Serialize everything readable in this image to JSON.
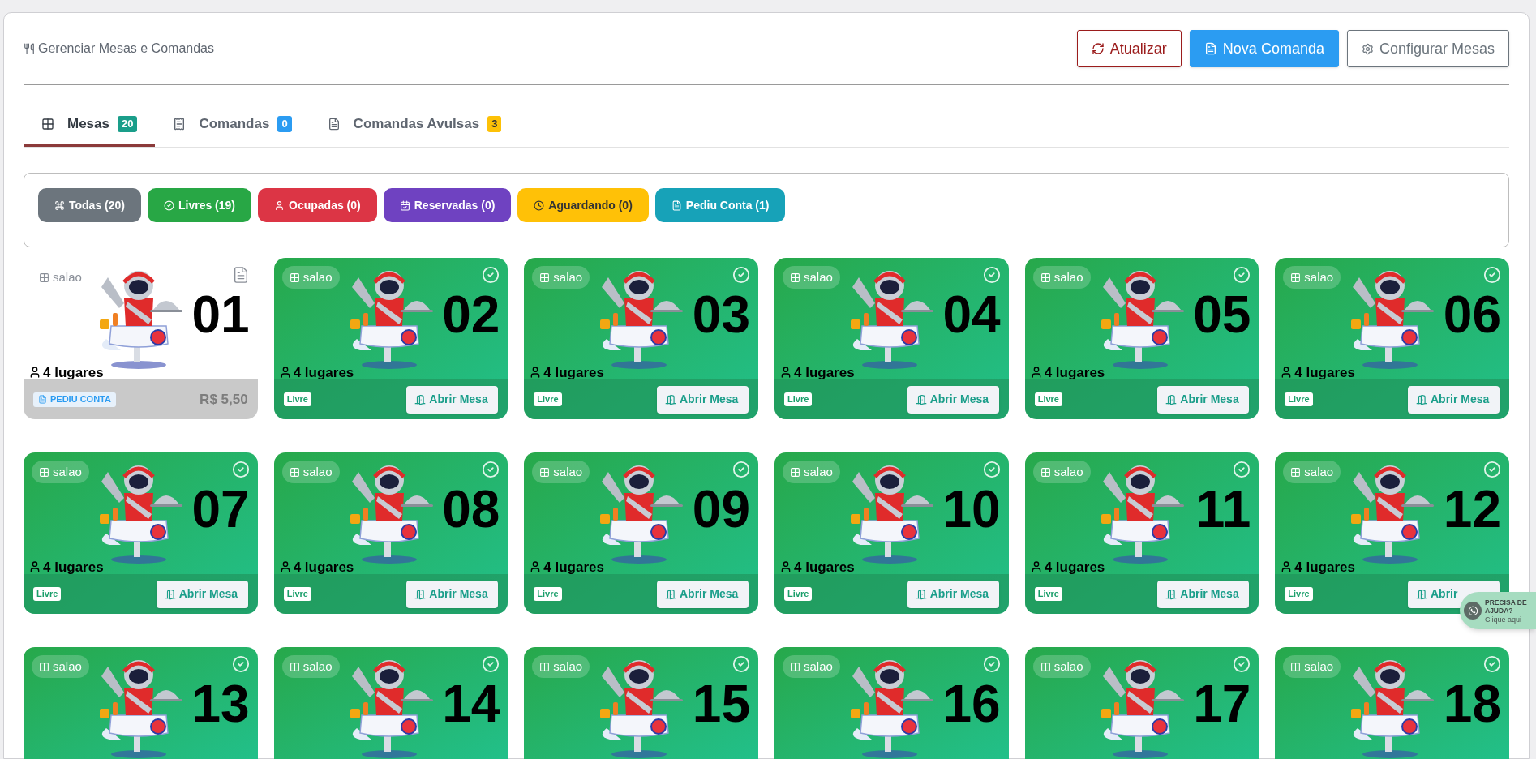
{
  "header": {
    "title": "Gerenciar Mesas e Comandas",
    "buttons": [
      {
        "label": "Atualizar",
        "kind": "refresh"
      },
      {
        "label": "Nova Comanda",
        "kind": "new"
      },
      {
        "label": "Configurar Mesas",
        "kind": "settings"
      }
    ]
  },
  "tabs": [
    {
      "label": "Mesas",
      "count": "20",
      "kind": "tables",
      "selected": true,
      "color": "#1a9e8a"
    },
    {
      "label": "Comandas",
      "count": "0",
      "kind": "orders",
      "selected": false,
      "color": "#2b9cf2"
    },
    {
      "label": "Comandas Avulsas",
      "count": "3",
      "kind": "loose",
      "selected": false,
      "color": "#fdc107"
    }
  ],
  "filters": [
    {
      "label": "Todas (20)",
      "kind": "all",
      "color": "#6c757d"
    },
    {
      "label": "Livres (19)",
      "kind": "free",
      "color": "#28a745"
    },
    {
      "label": "Ocupadas (0)",
      "kind": "occupied",
      "color": "#dc3545"
    },
    {
      "label": "Reservadas (0)",
      "kind": "reserved",
      "color": "#6f42c1"
    },
    {
      "label": "Aguardando (0)",
      "kind": "waiting",
      "color": "#ffc107"
    },
    {
      "label": "Pediu Conta (1)",
      "kind": "bill",
      "color": "#17a2b8"
    }
  ],
  "tables": [
    {
      "area": "salao",
      "number": "01",
      "seats": "4 lugares",
      "kind": "bill",
      "badge": "PEDIU CONTA",
      "amount": "R$ 5,50"
    },
    {
      "area": "salao",
      "number": "02",
      "seats": "4 lugares",
      "kind": "free",
      "badge": "Livre",
      "action": "Abrir Mesa"
    },
    {
      "area": "salao",
      "number": "03",
      "seats": "4 lugares",
      "kind": "free",
      "badge": "Livre",
      "action": "Abrir Mesa"
    },
    {
      "area": "salao",
      "number": "04",
      "seats": "4 lugares",
      "kind": "free",
      "badge": "Livre",
      "action": "Abrir Mesa"
    },
    {
      "area": "salao",
      "number": "05",
      "seats": "4 lugares",
      "kind": "free",
      "badge": "Livre",
      "action": "Abrir Mesa"
    },
    {
      "area": "salao",
      "number": "06",
      "seats": "4 lugares",
      "kind": "free",
      "badge": "Livre",
      "action": "Abrir Mesa"
    },
    {
      "area": "salao",
      "number": "07",
      "seats": "4 lugares",
      "kind": "free",
      "badge": "Livre",
      "action": "Abrir Mesa"
    },
    {
      "area": "salao",
      "number": "08",
      "seats": "4 lugares",
      "kind": "free",
      "badge": "Livre",
      "action": "Abrir Mesa"
    },
    {
      "area": "salao",
      "number": "09",
      "seats": "4 lugares",
      "kind": "free",
      "badge": "Livre",
      "action": "Abrir Mesa"
    },
    {
      "area": "salao",
      "number": "10",
      "seats": "4 lugares",
      "kind": "free",
      "badge": "Livre",
      "action": "Abrir Mesa"
    },
    {
      "area": "salao",
      "number": "11",
      "seats": "4 lugares",
      "kind": "free",
      "badge": "Livre",
      "action": "Abrir Mesa"
    },
    {
      "area": "salao",
      "number": "12",
      "seats": "4 lugares",
      "kind": "free",
      "badge": "Livre",
      "action": "Abrir"
    },
    {
      "area": "salao",
      "number": "13",
      "kind": "free"
    },
    {
      "area": "salao",
      "number": "14",
      "kind": "free"
    },
    {
      "area": "salao",
      "number": "15",
      "kind": "free"
    },
    {
      "area": "salao",
      "number": "16",
      "kind": "free"
    },
    {
      "area": "salao",
      "number": "17",
      "kind": "free"
    },
    {
      "area": "salao",
      "number": "18",
      "kind": "free"
    }
  ],
  "help": {
    "title": "PRECISA DE",
    "title_2": "AJUDA?",
    "subtitle": "Clique aqui"
  }
}
